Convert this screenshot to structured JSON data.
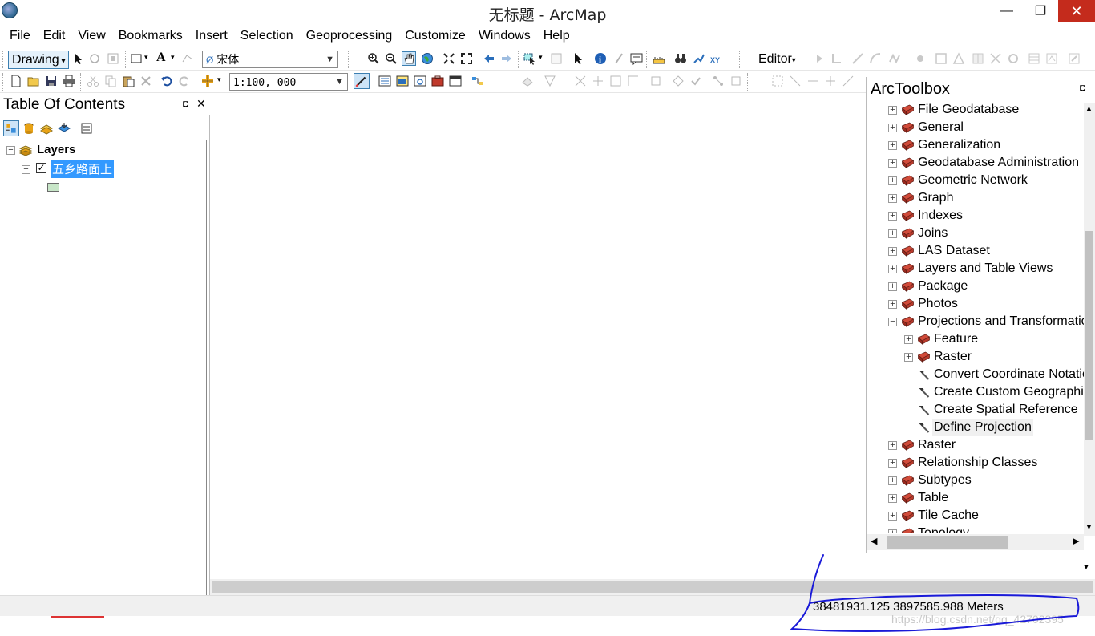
{
  "window": {
    "title": "无标题 - ArcMap",
    "minimize_glyph": "—",
    "maximize_glyph": "❐",
    "close_glyph": "✕"
  },
  "menu": [
    "File",
    "Edit",
    "View",
    "Bookmarks",
    "Insert",
    "Selection",
    "Geoprocessing",
    "Customize",
    "Windows",
    "Help"
  ],
  "toolbar": {
    "drawing_label": "Drawing",
    "font_name": "宋体",
    "text_tool": "A",
    "editor_label": "Editor",
    "scale": "1:100, 000"
  },
  "toc": {
    "title": "Table Of Contents",
    "root_label": "Layers",
    "layer_label": "五乡路面上",
    "layer_checked": true,
    "pin_glyph": "◘",
    "close_glyph": "✕"
  },
  "toolbox": {
    "title": "ArcToolbox",
    "items": [
      {
        "label": "File Geodatabase",
        "type": "toolbox",
        "expand": "+"
      },
      {
        "label": "General",
        "type": "toolbox",
        "expand": "+"
      },
      {
        "label": "Generalization",
        "type": "toolbox",
        "expand": "+"
      },
      {
        "label": "Geodatabase Administration",
        "type": "toolbox",
        "expand": "+"
      },
      {
        "label": "Geometric Network",
        "type": "toolbox",
        "expand": "+"
      },
      {
        "label": "Graph",
        "type": "toolbox",
        "expand": "+"
      },
      {
        "label": "Indexes",
        "type": "toolbox",
        "expand": "+"
      },
      {
        "label": "Joins",
        "type": "toolbox",
        "expand": "+"
      },
      {
        "label": "LAS Dataset",
        "type": "toolbox",
        "expand": "+"
      },
      {
        "label": "Layers and Table Views",
        "type": "toolbox",
        "expand": "+"
      },
      {
        "label": "Package",
        "type": "toolbox",
        "expand": "+"
      },
      {
        "label": "Photos",
        "type": "toolbox",
        "expand": "+"
      },
      {
        "label": "Projections and Transformations",
        "type": "toolbox",
        "expand": "−"
      },
      {
        "label": "Feature",
        "type": "toolbox",
        "expand": "+",
        "child": true
      },
      {
        "label": "Raster",
        "type": "toolbox",
        "expand": "+",
        "child": true
      },
      {
        "label": "Convert Coordinate Notation",
        "type": "tool",
        "child": true
      },
      {
        "label": "Create Custom Geographic Transformation",
        "type": "tool",
        "child": true
      },
      {
        "label": "Create Spatial Reference",
        "type": "tool",
        "child": true
      },
      {
        "label": "Define Projection",
        "type": "tool",
        "child": true,
        "highlight": true
      },
      {
        "label": "Raster",
        "type": "toolbox",
        "expand": "+"
      },
      {
        "label": "Relationship Classes",
        "type": "toolbox",
        "expand": "+"
      },
      {
        "label": "Subtypes",
        "type": "toolbox",
        "expand": "+"
      },
      {
        "label": "Table",
        "type": "toolbox",
        "expand": "+"
      },
      {
        "label": "Tile Cache",
        "type": "toolbox",
        "expand": "+"
      },
      {
        "label": "Topology",
        "type": "toolbox",
        "expand": "+"
      }
    ]
  },
  "status": {
    "coordinates": "38481931.125  3897585.988 Meters"
  },
  "watermark": "https://blog.csdn.net/qq_42702395",
  "colors": {
    "selection": "#3399ff",
    "close_red": "#c42b1c",
    "annotation": "#1a1ad8",
    "toolbox_red": "#b82424",
    "layer_fill": "#c8e6c8"
  }
}
